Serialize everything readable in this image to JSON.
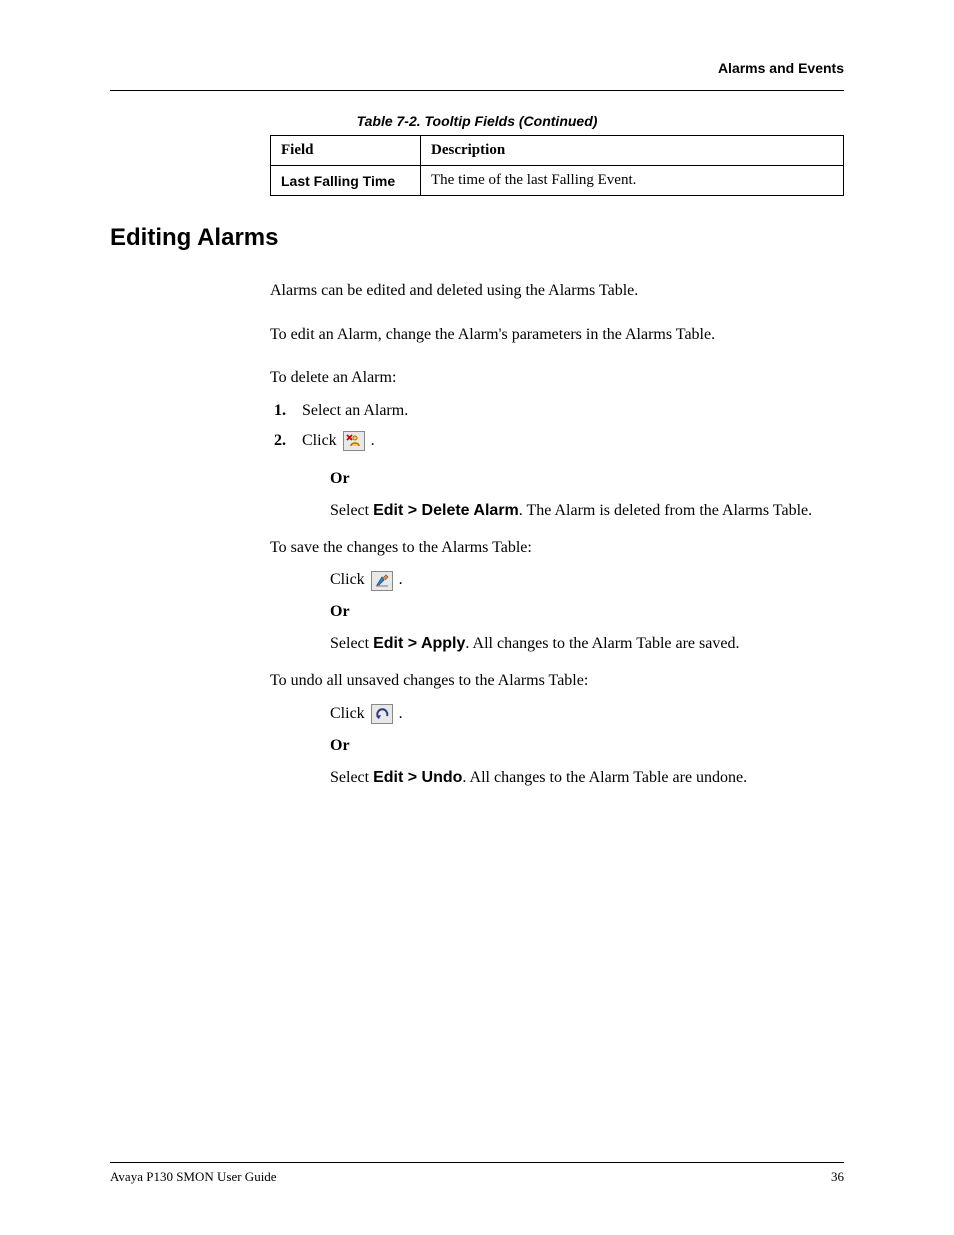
{
  "header": {
    "title": "Alarms and Events"
  },
  "table": {
    "caption": "Table 7-2.  Tooltip Fields (Continued)",
    "headers": {
      "field": "Field",
      "desc": "Description"
    },
    "rows": [
      {
        "field": "Last Falling Time",
        "desc": "The time of the last Falling Event."
      }
    ]
  },
  "section": {
    "title": "Editing Alarms"
  },
  "body": {
    "p1": "Alarms can be edited and deleted using the Alarms Table.",
    "p2": "To edit an Alarm, change the Alarm's parameters in the Alarms Table.",
    "p3": "To delete an Alarm:",
    "steps_delete": {
      "s1_num": "1.",
      "s1_text": "Select an Alarm.",
      "s2_num": "2.",
      "s2_click": "Click ",
      "s2_dot": ".",
      "or1": "Or",
      "s2_alt_a": "Select ",
      "s2_alt_b": "Edit > Delete Alarm",
      "s2_alt_c": ". The Alarm is deleted from the Alarms Table."
    },
    "p4": "To save the changes to the Alarms Table:",
    "save": {
      "click": "Click ",
      "dot": ".",
      "or": "Or",
      "alt_a": "Select ",
      "alt_b": "Edit > Apply",
      "alt_c": ". All changes to the Alarm Table are saved."
    },
    "p5": "To undo all unsaved changes to the Alarms Table:",
    "undo": {
      "click": "Click ",
      "dot": ".",
      "or": "Or",
      "alt_a": "Select ",
      "alt_b": "Edit > Undo",
      "alt_c": ". All changes to the Alarm Table are undone."
    }
  },
  "footer": {
    "left": "Avaya P130 SMON User Guide",
    "right": "36"
  }
}
